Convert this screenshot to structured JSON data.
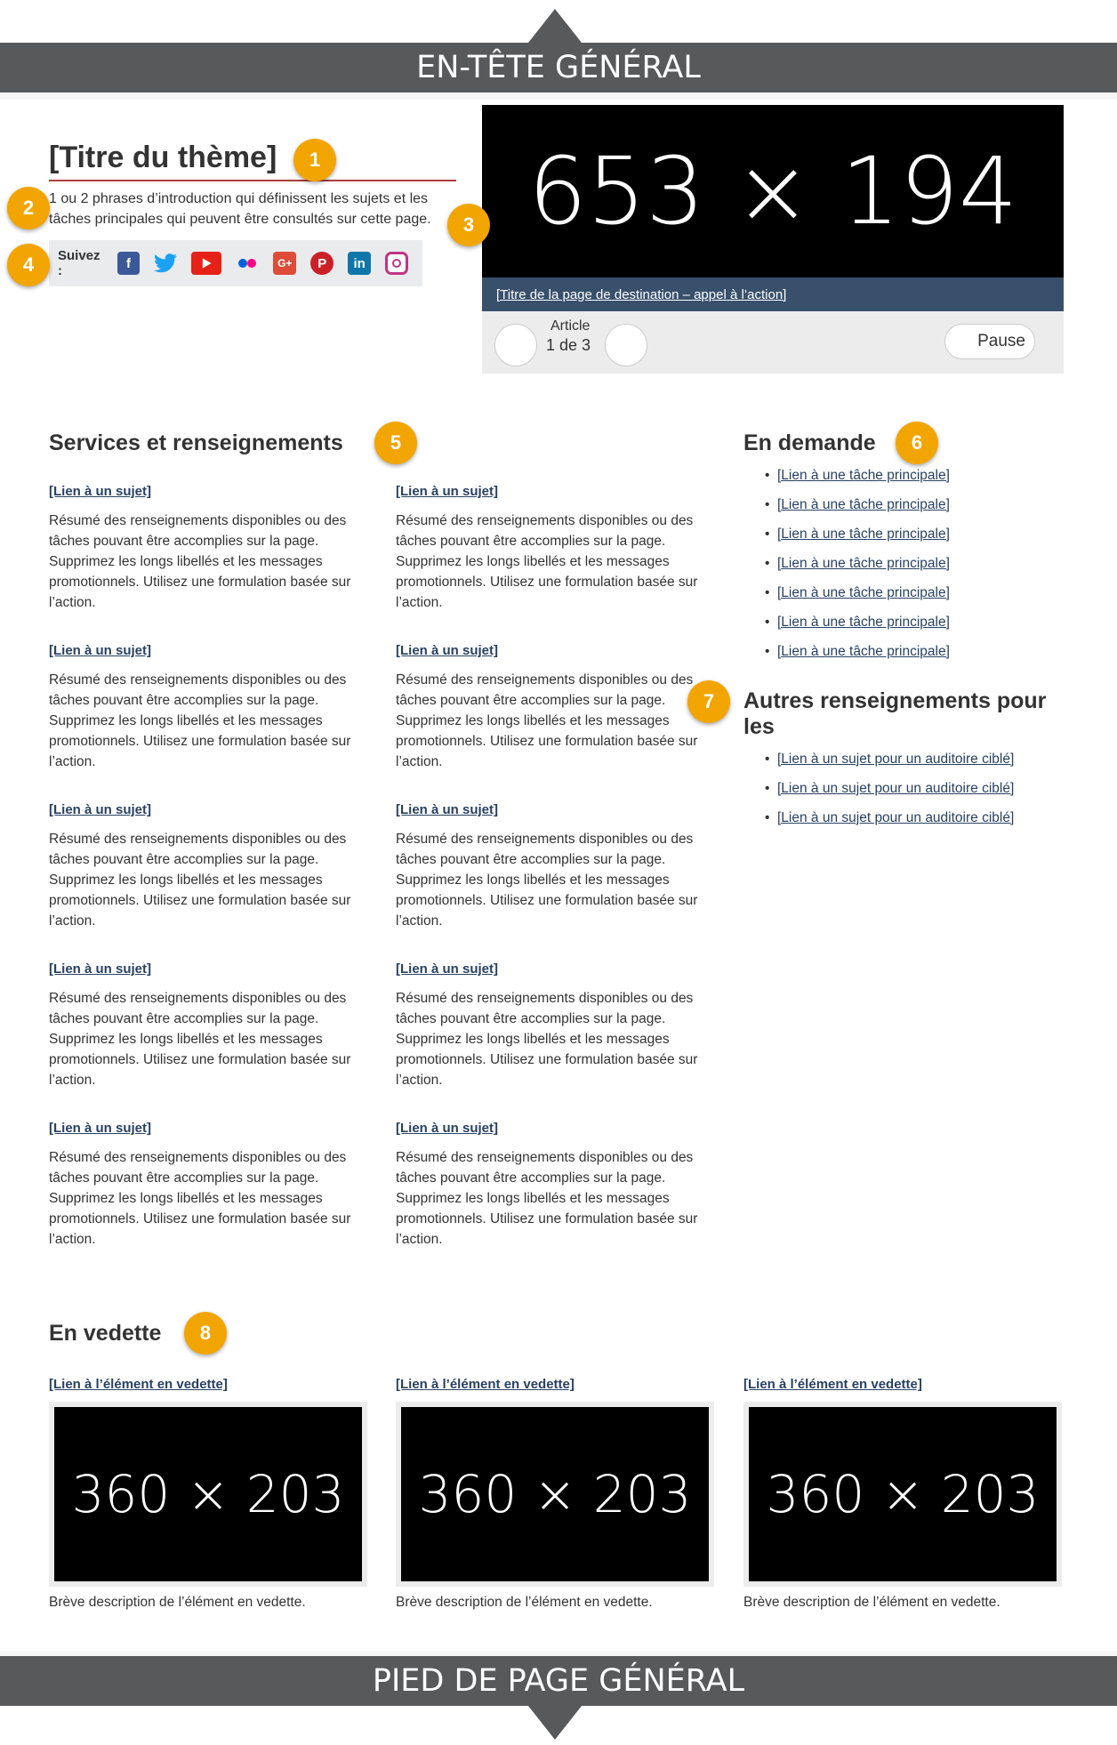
{
  "header_band": "EN-TÊTE GÉNÉRAL",
  "footer_band": "PIED DE PAGE GÉNÉRAL",
  "badges": [
    "1",
    "2",
    "3",
    "4",
    "5",
    "6",
    "7",
    "8"
  ],
  "intro": {
    "title": "[Titre du thème]",
    "text": "1 ou 2 phrases d’introduction qui définissent les sujets et les tâches principales qui peuvent être consultés sur cette page.",
    "follow_label": "Suivez :",
    "social_icons": [
      "facebook-icon",
      "twitter-icon",
      "youtube-icon",
      "flickr-icon",
      "google-plus-icon",
      "pinterest-icon",
      "linkedin-icon",
      "instagram-icon"
    ]
  },
  "carousel": {
    "image_text": "653 × 194",
    "caption_link": "[Titre de la page de destination – appel à l’action]",
    "item_label": "Article",
    "item_count": "1 de 3",
    "pause_label": "Pause"
  },
  "services": {
    "heading": "Services et renseignements",
    "link_label": "[Lien à un sujet]",
    "desc": "Résumé des renseignements disponibles ou des tâches pouvant être accomplies sur la page. Supprimez les longs libellés et les messages promotionnels. Utilisez une formulation basée sur l’action.",
    "items": [
      {
        "link": "[Lien à un sujet]",
        "desc": "Résumé des renseignements disponibles ou des tâches pouvant être accomplies sur la page. Supprimez les longs libellés et les messages promotionnels. Utilisez une formulation basée sur l’action."
      },
      {
        "link": "[Lien à un sujet]",
        "desc": "Résumé des renseignements disponibles ou des tâches pouvant être accomplies sur la page. Supprimez les longs libellés et les messages promotionnels. Utilisez une formulation basée sur l’action."
      },
      {
        "link": "[Lien à un sujet]",
        "desc": "Résumé des renseignements disponibles ou des tâches pouvant être accomplies sur la page. Supprimez les longs libellés et les messages promotionnels. Utilisez une formulation basée sur l’action."
      },
      {
        "link": "[Lien à un sujet]",
        "desc": "Résumé des renseignements disponibles ou des tâches pouvant être accomplies sur la page. Supprimez les longs libellés et les messages promotionnels. Utilisez une formulation basée sur l’action."
      },
      {
        "link": "[Lien à un sujet]",
        "desc": "Résumé des renseignements disponibles ou des tâches pouvant être accomplies sur la page. Supprimez les longs libellés et les messages promotionnels. Utilisez une formulation basée sur l’action."
      },
      {
        "link": "[Lien à un sujet]",
        "desc": "Résumé des renseignements disponibles ou des tâches pouvant être accomplies sur la page. Supprimez les longs libellés et les messages promotionnels. Utilisez une formulation basée sur l’action."
      },
      {
        "link": "[Lien à un sujet]",
        "desc": "Résumé des renseignements disponibles ou des tâches pouvant être accomplies sur la page. Supprimez les longs libellés et les messages promotionnels. Utilisez une formulation basée sur l’action."
      },
      {
        "link": "[Lien à un sujet]",
        "desc": "Résumé des renseignements disponibles ou des tâches pouvant être accomplies sur la page. Supprimez les longs libellés et les messages promotionnels. Utilisez une formulation basée sur l’action."
      },
      {
        "link": "[Lien à un sujet]",
        "desc": "Résumé des renseignements disponibles ou des tâches pouvant être accomplies sur la page. Supprimez les longs libellés et les messages promotionnels. Utilisez une formulation basée sur l’action."
      },
      {
        "link": "[Lien à un sujet]",
        "desc": "Résumé des renseignements disponibles ou des tâches pouvant être accomplies sur la page. Supprimez les longs libellés et les messages promotionnels. Utilisez une formulation basée sur l’action."
      }
    ]
  },
  "in_demand": {
    "heading": "En demande",
    "items": [
      "[Lien à une tâche principale]",
      "[Lien à une tâche principale]",
      "[Lien à une tâche principale]",
      "[Lien à une tâche principale]",
      "[Lien à une tâche principale]",
      "[Lien à une tâche principale]",
      "[Lien à une tâche principale]"
    ]
  },
  "other_info": {
    "heading": "Autres renseignements pour les",
    "items": [
      "[Lien à un sujet pour un auditoire ciblé]",
      "[Lien à un sujet pour un auditoire ciblé]",
      "[Lien à un sujet pour un auditoire ciblé]"
    ]
  },
  "featured": {
    "heading": "En vedette",
    "items": [
      {
        "link": "[Lien à l’élément en vedette]",
        "image_text": "360 × 203",
        "desc": "Brève description de l’élément en vedette."
      },
      {
        "link": "[Lien à l’élément en vedette]",
        "image_text": "360 × 203",
        "desc": "Brève description de l’élément en vedette."
      },
      {
        "link": "[Lien à l’élément en vedette]",
        "image_text": "360 × 203",
        "desc": "Brève description de l’élément en vedette."
      }
    ]
  },
  "colors": {
    "band": "#58595b",
    "badge": "#f2a500",
    "link": "#284162",
    "title_rule": "#af3c43",
    "caption_bg": "#38506b"
  }
}
